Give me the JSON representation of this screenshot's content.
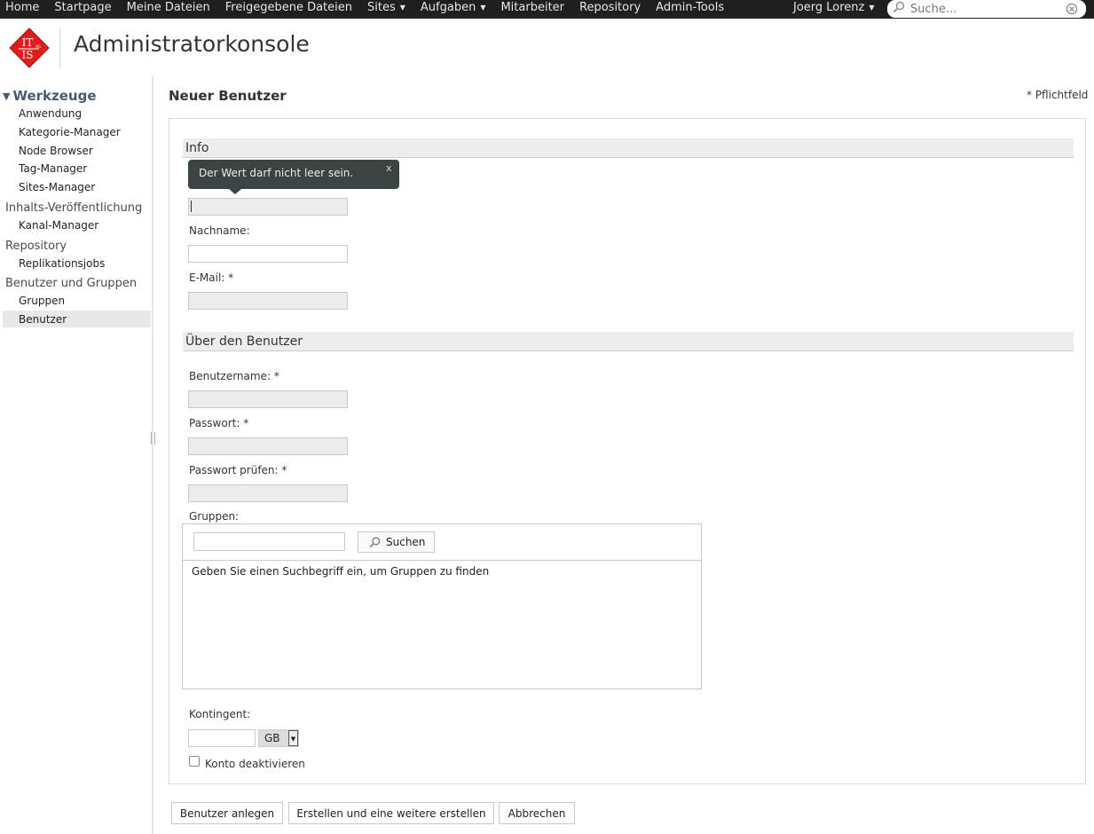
{
  "topbar": {
    "nav": [
      {
        "label": "Home",
        "dropdown": false
      },
      {
        "label": "Startpage",
        "dropdown": false
      },
      {
        "label": "Meine Dateien",
        "dropdown": false
      },
      {
        "label": "Freigegebene Dateien",
        "dropdown": false
      },
      {
        "label": "Sites",
        "dropdown": true
      },
      {
        "label": "Aufgaben",
        "dropdown": true
      },
      {
        "label": "Mitarbeiter",
        "dropdown": false
      },
      {
        "label": "Repository",
        "dropdown": false
      },
      {
        "label": "Admin-Tools",
        "dropdown": false
      }
    ],
    "user": "Joerg Lorenz",
    "dropdown_arrow": "▼",
    "search_placeholder": "Suche..."
  },
  "header": {
    "title": "Administratorkonsole",
    "logo": {
      "line1": "IT",
      "line2": "IS",
      "small": "AG",
      "color": "#e21c1c"
    }
  },
  "sidebar": {
    "tools_head": "Werkzeuge",
    "tools_tri": "▼",
    "tools": [
      "Anwendung",
      "Kategorie-Manager",
      "Node Browser",
      "Tag-Manager",
      "Sites-Manager"
    ],
    "publish_head": "Inhalts-Veröffentlichung",
    "publish": [
      "Kanal-Manager"
    ],
    "repo_head": "Repository",
    "repo": [
      "Replikationsjobs"
    ],
    "users_head": "Benutzer und Gruppen",
    "users": [
      "Gruppen",
      "Benutzer"
    ],
    "selected": "Benutzer"
  },
  "main": {
    "title": "Neuer Benutzer",
    "required_note": "* Pflichtfeld",
    "info_section": "Info",
    "tooltip": {
      "message": "Der Wert darf nicht leer sein.",
      "close": "x"
    },
    "lastname_label": "Nachname:",
    "email_label": "E-Mail: *",
    "about_section": "Über den Benutzer",
    "username_label": "Benutzername: *",
    "password_label": "Passwort: *",
    "password_confirm_label": "Passwort prüfen: *",
    "groups_label": "Gruppen:",
    "groups_search_button": "Suchen",
    "groups_hint": "Geben Sie einen Suchbegriff ein, um Gruppen zu finden",
    "quota_label": "Kontingent:",
    "quota_unit": "GB",
    "disable_account_label": "Konto deaktivieren"
  },
  "buttons": {
    "create": "Benutzer anlegen",
    "create_another": "Erstellen und eine weitere erstellen",
    "cancel": "Abbrechen"
  }
}
